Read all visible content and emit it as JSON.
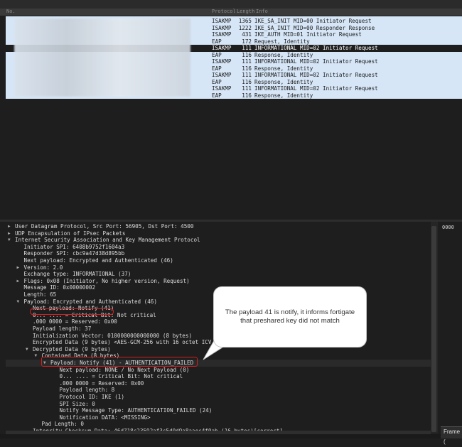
{
  "columns": {
    "no": "No.",
    "protocol": "Protocol",
    "length": "Length",
    "info": "Info"
  },
  "packets": [
    {
      "protocol": "ISAKMP",
      "length": "1365",
      "info": "IKE_SA_INIT MID=00 Initiator Request",
      "selected": false
    },
    {
      "protocol": "ISAKMP",
      "length": "1222",
      "info": "IKE_SA_INIT MID=00 Responder Response",
      "selected": false
    },
    {
      "protocol": "ISAKMP",
      "length": "431",
      "info": "IKE_AUTH MID=01 Initiator Request",
      "selected": false
    },
    {
      "protocol": "EAP",
      "length": "172",
      "info": "Request, Identity",
      "selected": false
    },
    {
      "protocol": "ISAKMP",
      "length": "111",
      "info": "INFORMATIONAL MID=02 Initiator Request",
      "selected": true
    },
    {
      "protocol": "EAP",
      "length": "116",
      "info": "Response, Identity",
      "selected": false
    },
    {
      "protocol": "ISAKMP",
      "length": "111",
      "info": "INFORMATIONAL MID=02 Initiator Request",
      "selected": false
    },
    {
      "protocol": "EAP",
      "length": "116",
      "info": "Response, Identity",
      "selected": false
    },
    {
      "protocol": "ISAKMP",
      "length": "111",
      "info": "INFORMATIONAL MID=02 Initiator Request",
      "selected": false
    },
    {
      "protocol": "EAP",
      "length": "116",
      "info": "Response, Identity",
      "selected": false
    },
    {
      "protocol": "ISAKMP",
      "length": "111",
      "info": "INFORMATIONAL MID=02 Initiator Request",
      "selected": false
    },
    {
      "protocol": "EAP",
      "length": "116",
      "info": "Response, Identity",
      "selected": false
    }
  ],
  "details": [
    {
      "text": "User Datagram Protocol, Src Port: 56905, Dst Port: 4500",
      "indent": 0,
      "arrow": "right"
    },
    {
      "text": "UDP Encapsulation of IPsec Packets",
      "indent": 0,
      "arrow": "right"
    },
    {
      "text": "Internet Security Association and Key Management Protocol",
      "indent": 0,
      "arrow": "down"
    },
    {
      "text": "Initiator SPI: 6408b9752f1604a3",
      "indent": 1,
      "arrow": ""
    },
    {
      "text": "Responder SPI: cbc9a47d38d895bb",
      "indent": 1,
      "arrow": ""
    },
    {
      "text": "Next payload: Encrypted and Authenticated (46)",
      "indent": 1,
      "arrow": ""
    },
    {
      "text": "Version: 2.0",
      "indent": 1,
      "arrow": "right"
    },
    {
      "text": "Exchange type: INFORMATIONAL (37)",
      "indent": 1,
      "arrow": ""
    },
    {
      "text": "Flags: 0x08 (Initiator, No higher version, Request)",
      "indent": 1,
      "arrow": "right"
    },
    {
      "text": "Message ID: 0x00000002",
      "indent": 1,
      "arrow": ""
    },
    {
      "text": "Length: 65",
      "indent": 1,
      "arrow": ""
    },
    {
      "text": "Payload: Encrypted and Authenticated (46)",
      "indent": 1,
      "arrow": "down"
    },
    {
      "text": "Next payload: Notify (41)",
      "indent": 2,
      "arrow": ""
    },
    {
      "text": "0... .... = Critical Bit: Not critical",
      "indent": 2,
      "arrow": ""
    },
    {
      "text": ".000 0000 = Reserved: 0x00",
      "indent": 2,
      "arrow": ""
    },
    {
      "text": "Payload length: 37",
      "indent": 2,
      "arrow": ""
    },
    {
      "text": "Initialization Vector: 0100000000000000 (8 bytes)",
      "indent": 2,
      "arrow": ""
    },
    {
      "text": "Encrypted Data (9 bytes) <AES-GCM-256 with 16 octet ICV [",
      "indent": 2,
      "arrow": ""
    },
    {
      "text": "Decrypted Data (9 bytes)",
      "indent": 2,
      "arrow": "down"
    },
    {
      "text": "Contained Data (8 bytes)",
      "indent": 3,
      "arrow": "down"
    },
    {
      "text": "Payload: Notify (41) - AUTHENTICATION_FAILED",
      "indent": 4,
      "arrow": "down"
    },
    {
      "text": "Next payload: NONE / No Next Payload (0)",
      "indent": 5,
      "arrow": ""
    },
    {
      "text": "0... .... = Critical Bit: Not critical",
      "indent": 5,
      "arrow": ""
    },
    {
      "text": ".000 0000 = Reserved: 0x00",
      "indent": 5,
      "arrow": ""
    },
    {
      "text": "Payload length: 8",
      "indent": 5,
      "arrow": ""
    },
    {
      "text": "Protocol ID: IKE (1)",
      "indent": 5,
      "arrow": ""
    },
    {
      "text": "SPI Size: 0",
      "indent": 5,
      "arrow": ""
    },
    {
      "text": "Notify Message Type: AUTHENTICATION_FAILED (24)",
      "indent": 5,
      "arrow": ""
    },
    {
      "text": "Notification DATA: <MISSING>",
      "indent": 5,
      "arrow": ""
    },
    {
      "text": "Pad Length: 0",
      "indent": 3,
      "arrow": ""
    },
    {
      "text": "Integrity Checksum Data: 46d718c23592af3c5d0d9a8aaec4f0ab (16 bytes)[correct]",
      "indent": 2,
      "arrow": ""
    }
  ],
  "callout": {
    "text": "The payload 41 is notify, it informs fortigate that preshared key did not match"
  },
  "bytes_pane": {
    "offset": "0000"
  },
  "frame_tab": {
    "label": "Frame ("
  }
}
